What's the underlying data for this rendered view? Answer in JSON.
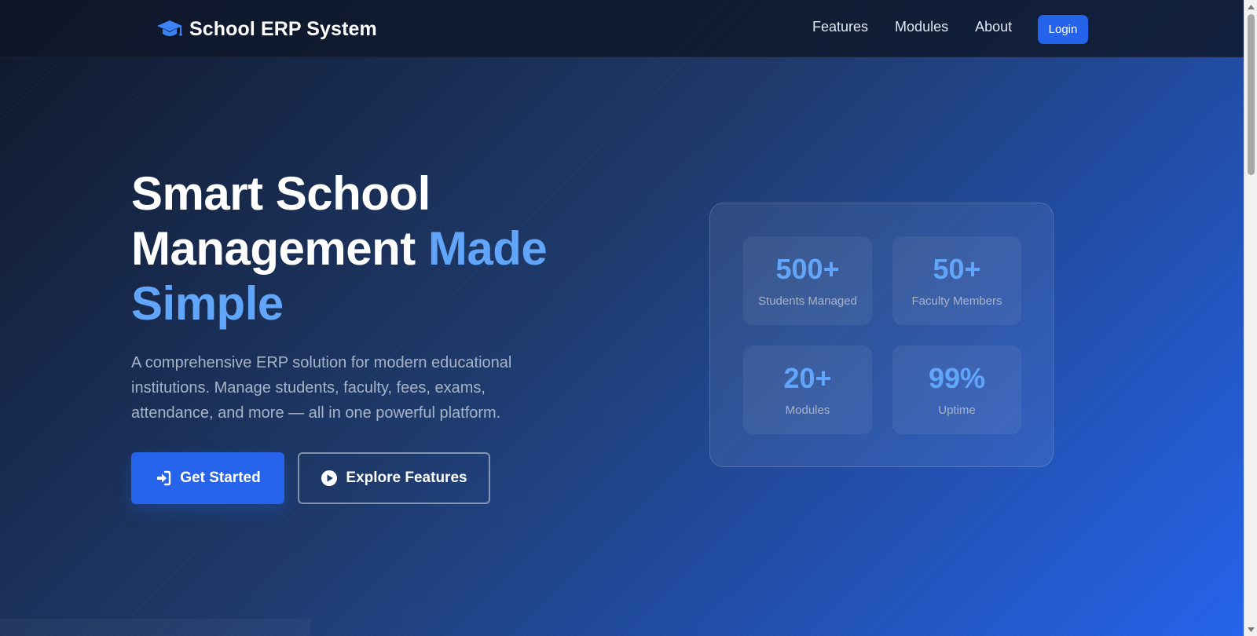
{
  "navbar": {
    "brand": "School ERP System",
    "brand_icon": "graduation-cap-icon",
    "links": [
      "Features",
      "Modules",
      "About"
    ],
    "login_label": "Login"
  },
  "hero": {
    "title_line1": "Smart School",
    "title_line2": "Management",
    "title_accent_a": "Made",
    "title_accent_b": "Simple",
    "description": "A comprehensive ERP solution for modern educational institutions. Manage students, faculty, fees, exams, attendance, and more — all in one powerful platform.",
    "primary_button": {
      "label": "Get Started",
      "icon": "sign-in-icon"
    },
    "secondary_button": {
      "label": "Explore Features",
      "icon": "play-circle-icon"
    }
  },
  "stats": [
    {
      "value": "500+",
      "label": "Students Managed"
    },
    {
      "value": "50+",
      "label": "Faculty Members"
    },
    {
      "value": "20+",
      "label": "Modules"
    },
    {
      "value": "99%",
      "label": "Uptime"
    }
  ],
  "colors": {
    "accent": "#60a5fa",
    "primary": "#2563eb",
    "navbar_bg": "#0f172a",
    "text_muted": "#a7b4c8"
  }
}
